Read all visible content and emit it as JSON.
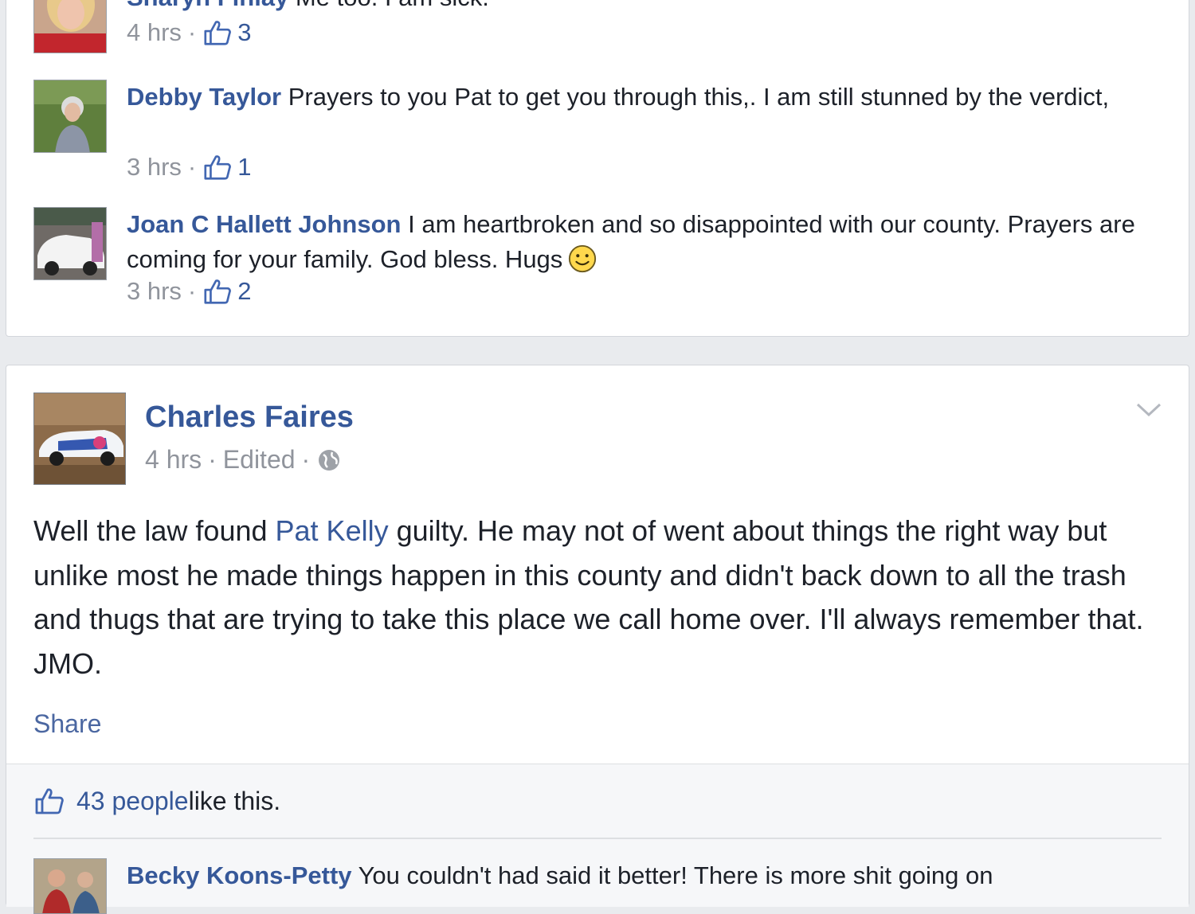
{
  "comments_top": [
    {
      "author": "Sharyn Finlay",
      "text": "Me too. I am sick.",
      "time": "4 hrs",
      "likes": "3"
    },
    {
      "author": "Debby Taylor",
      "text": "Prayers to you Pat to get you through this,. I am still stunned by the verdict,",
      "time": "3 hrs",
      "likes": "1"
    },
    {
      "author": "Joan C Hallett Johnson",
      "text": "I am heartbroken and so disappointed with our county. Prayers are coming for your family. God bless. Hugs",
      "time": "3 hrs",
      "likes": "2"
    }
  ],
  "post": {
    "author": "Charles Faires",
    "time": "4 hrs",
    "edited": "Edited",
    "body_before": "Well the law found ",
    "mention": "Pat Kelly",
    "body_after": " guilty. He may not of went about things the right way but unlike most he made things happen in this county and didn't back down to all the trash and thugs that are trying to take this place we call home over. I'll always remember that. JMO.",
    "share_label": "Share",
    "likes_count": "43 people",
    "likes_rest": " like this."
  },
  "comment_bottom": {
    "author": "Becky Koons-Petty",
    "text": "You couldn't had said it better! There is more shit going on"
  },
  "colors": {
    "link": "#365899",
    "meta": "#90949c",
    "background": "#e9ebee"
  },
  "icons": [
    "thumbs-up-icon",
    "smiley-icon",
    "globe-icon",
    "chevron-down-icon"
  ]
}
